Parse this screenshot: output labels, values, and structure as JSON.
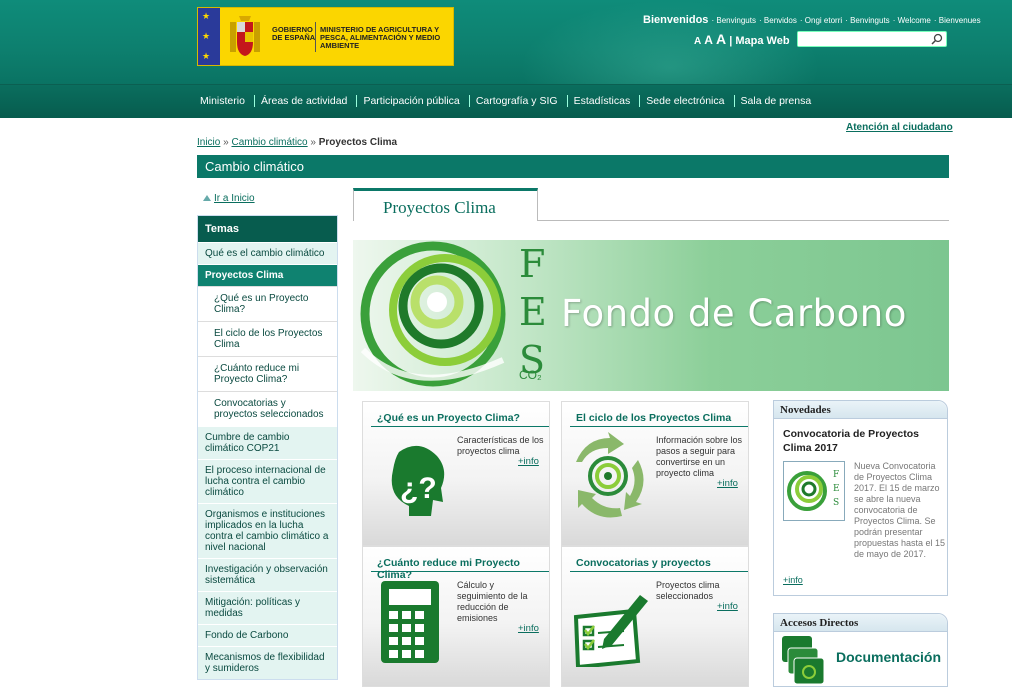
{
  "header": {
    "logo_gov": "GOBIERNO DE ESPAÑA",
    "logo_ministry": "MINISTERIO DE AGRICULTURA Y PESCA, ALIMENTACIÓN Y MEDIO AMBIENTE",
    "welcome": "Bienvenidos",
    "languages": [
      "Benvinguts",
      "Benvidos",
      "Ongi etorri",
      "Benvinguts",
      "Welcome",
      "Bienvenues"
    ],
    "text_size": [
      "A",
      "A",
      "A"
    ],
    "sitemap": "Mapa Web",
    "search_value": ""
  },
  "nav": [
    "Ministerio",
    "Áreas de actividad",
    "Participación pública",
    "Cartografía y SIG",
    "Estadísticas",
    "Sede electrónica",
    "Sala de prensa"
  ],
  "citizen_link": "Atención al ciudadano",
  "breadcrumb": {
    "home": "Inicio",
    "sep": "»",
    "level1": "Cambio climático",
    "current": "Proyectos Clima"
  },
  "section_title": "Cambio climático",
  "home_link": "Ir a Inicio",
  "sidebar": {
    "heading": "Temas",
    "items": [
      {
        "label": "Qué es el cambio climático",
        "kind": "item"
      },
      {
        "label": "Proyectos Clima",
        "kind": "selected"
      },
      {
        "label": "¿Qué es un Proyecto Clima?",
        "kind": "sub"
      },
      {
        "label": "El ciclo de los Proyectos Clima",
        "kind": "sub"
      },
      {
        "label": "¿Cuánto reduce mi Proyecto Clima?",
        "kind": "sub"
      },
      {
        "label": "Convocatorias y proyectos seleccionados",
        "kind": "sub"
      },
      {
        "label": "Cumbre de cambio climático COP21",
        "kind": "item"
      },
      {
        "label": "El proceso internacional de lucha contra el cambio climático",
        "kind": "item"
      },
      {
        "label": "Organismos e instituciones implicados en la lucha contra el cambio climático a nivel nacional",
        "kind": "item"
      },
      {
        "label": "Investigación y observación sistemática",
        "kind": "item"
      },
      {
        "label": "Mitigación: políticas y medidas",
        "kind": "item"
      },
      {
        "label": "Fondo de Carbono",
        "kind": "item"
      },
      {
        "label": "Mecanismos de flexibilidad y sumideros",
        "kind": "item"
      }
    ]
  },
  "tab": "Proyectos Clima",
  "banner": {
    "title": "Fondo de Carbono",
    "letters": [
      "F",
      "E",
      "S"
    ],
    "co2": "CO₂"
  },
  "cards": [
    {
      "title": "¿Qué es un Proyecto Clima?",
      "desc": "Características de los proyectos clima",
      "more": "+info",
      "icon": "head-question-icon"
    },
    {
      "title": "El ciclo de los Proyectos Clima",
      "desc": "Información sobre los pasos a seguir para convertirse en un proyecto clima",
      "more": "+info",
      "icon": "recycle-cycle-icon"
    },
    {
      "title": "¿Cuánto reduce mi Proyecto Clima?",
      "desc": "Cálculo y seguimiento de la reducción de emisiones",
      "more": "+info",
      "icon": "calculator-icon"
    },
    {
      "title": "Convocatorias y proyectos",
      "desc": "Proyectos clima seleccionados",
      "more": "+info",
      "icon": "checklist-pen-icon"
    }
  ],
  "novedades": {
    "heading": "Novedades",
    "title": "Convocatoria de Proyectos Clima 2017",
    "text": "Nueva Convocatoria de Proyectos Clima 2017. El 15 de marzo se abre la nueva convocatoria de Proyectos Clima. Se podrán presentar propuestas hasta el 15 de mayo de 2017.",
    "more": "+info"
  },
  "accesos": {
    "heading": "Accesos Directos",
    "doc": "Documentación"
  }
}
